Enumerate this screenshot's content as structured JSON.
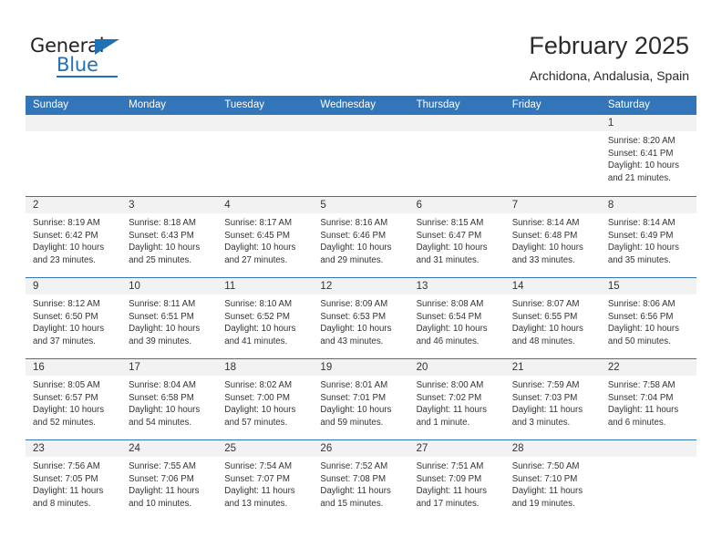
{
  "brand": {
    "name_top": "General",
    "name_bottom": "Blue",
    "color": "#2071b5"
  },
  "header": {
    "month_title": "February 2025",
    "location": "Archidona, Andalusia, Spain"
  },
  "calendar": {
    "header_color": "#3275b8",
    "weekdays": [
      "Sunday",
      "Monday",
      "Tuesday",
      "Wednesday",
      "Thursday",
      "Friday",
      "Saturday"
    ],
    "weeks": [
      [
        {
          "empty": true
        },
        {
          "empty": true
        },
        {
          "empty": true
        },
        {
          "empty": true
        },
        {
          "empty": true
        },
        {
          "empty": true
        },
        {
          "day": "1",
          "sunrise": "Sunrise: 8:20 AM",
          "sunset": "Sunset: 6:41 PM",
          "daylight_1": "Daylight: 10 hours",
          "daylight_2": "and 21 minutes."
        }
      ],
      [
        {
          "day": "2",
          "sunrise": "Sunrise: 8:19 AM",
          "sunset": "Sunset: 6:42 PM",
          "daylight_1": "Daylight: 10 hours",
          "daylight_2": "and 23 minutes."
        },
        {
          "day": "3",
          "sunrise": "Sunrise: 8:18 AM",
          "sunset": "Sunset: 6:43 PM",
          "daylight_1": "Daylight: 10 hours",
          "daylight_2": "and 25 minutes."
        },
        {
          "day": "4",
          "sunrise": "Sunrise: 8:17 AM",
          "sunset": "Sunset: 6:45 PM",
          "daylight_1": "Daylight: 10 hours",
          "daylight_2": "and 27 minutes."
        },
        {
          "day": "5",
          "sunrise": "Sunrise: 8:16 AM",
          "sunset": "Sunset: 6:46 PM",
          "daylight_1": "Daylight: 10 hours",
          "daylight_2": "and 29 minutes."
        },
        {
          "day": "6",
          "sunrise": "Sunrise: 8:15 AM",
          "sunset": "Sunset: 6:47 PM",
          "daylight_1": "Daylight: 10 hours",
          "daylight_2": "and 31 minutes."
        },
        {
          "day": "7",
          "sunrise": "Sunrise: 8:14 AM",
          "sunset": "Sunset: 6:48 PM",
          "daylight_1": "Daylight: 10 hours",
          "daylight_2": "and 33 minutes."
        },
        {
          "day": "8",
          "sunrise": "Sunrise: 8:14 AM",
          "sunset": "Sunset: 6:49 PM",
          "daylight_1": "Daylight: 10 hours",
          "daylight_2": "and 35 minutes."
        }
      ],
      [
        {
          "day": "9",
          "sunrise": "Sunrise: 8:12 AM",
          "sunset": "Sunset: 6:50 PM",
          "daylight_1": "Daylight: 10 hours",
          "daylight_2": "and 37 minutes."
        },
        {
          "day": "10",
          "sunrise": "Sunrise: 8:11 AM",
          "sunset": "Sunset: 6:51 PM",
          "daylight_1": "Daylight: 10 hours",
          "daylight_2": "and 39 minutes."
        },
        {
          "day": "11",
          "sunrise": "Sunrise: 8:10 AM",
          "sunset": "Sunset: 6:52 PM",
          "daylight_1": "Daylight: 10 hours",
          "daylight_2": "and 41 minutes."
        },
        {
          "day": "12",
          "sunrise": "Sunrise: 8:09 AM",
          "sunset": "Sunset: 6:53 PM",
          "daylight_1": "Daylight: 10 hours",
          "daylight_2": "and 43 minutes."
        },
        {
          "day": "13",
          "sunrise": "Sunrise: 8:08 AM",
          "sunset": "Sunset: 6:54 PM",
          "daylight_1": "Daylight: 10 hours",
          "daylight_2": "and 46 minutes."
        },
        {
          "day": "14",
          "sunrise": "Sunrise: 8:07 AM",
          "sunset": "Sunset: 6:55 PM",
          "daylight_1": "Daylight: 10 hours",
          "daylight_2": "and 48 minutes."
        },
        {
          "day": "15",
          "sunrise": "Sunrise: 8:06 AM",
          "sunset": "Sunset: 6:56 PM",
          "daylight_1": "Daylight: 10 hours",
          "daylight_2": "and 50 minutes."
        }
      ],
      [
        {
          "day": "16",
          "sunrise": "Sunrise: 8:05 AM",
          "sunset": "Sunset: 6:57 PM",
          "daylight_1": "Daylight: 10 hours",
          "daylight_2": "and 52 minutes."
        },
        {
          "day": "17",
          "sunrise": "Sunrise: 8:04 AM",
          "sunset": "Sunset: 6:58 PM",
          "daylight_1": "Daylight: 10 hours",
          "daylight_2": "and 54 minutes."
        },
        {
          "day": "18",
          "sunrise": "Sunrise: 8:02 AM",
          "sunset": "Sunset: 7:00 PM",
          "daylight_1": "Daylight: 10 hours",
          "daylight_2": "and 57 minutes."
        },
        {
          "day": "19",
          "sunrise": "Sunrise: 8:01 AM",
          "sunset": "Sunset: 7:01 PM",
          "daylight_1": "Daylight: 10 hours",
          "daylight_2": "and 59 minutes."
        },
        {
          "day": "20",
          "sunrise": "Sunrise: 8:00 AM",
          "sunset": "Sunset: 7:02 PM",
          "daylight_1": "Daylight: 11 hours",
          "daylight_2": "and 1 minute."
        },
        {
          "day": "21",
          "sunrise": "Sunrise: 7:59 AM",
          "sunset": "Sunset: 7:03 PM",
          "daylight_1": "Daylight: 11 hours",
          "daylight_2": "and 3 minutes."
        },
        {
          "day": "22",
          "sunrise": "Sunrise: 7:58 AM",
          "sunset": "Sunset: 7:04 PM",
          "daylight_1": "Daylight: 11 hours",
          "daylight_2": "and 6 minutes."
        }
      ],
      [
        {
          "day": "23",
          "sunrise": "Sunrise: 7:56 AM",
          "sunset": "Sunset: 7:05 PM",
          "daylight_1": "Daylight: 11 hours",
          "daylight_2": "and 8 minutes."
        },
        {
          "day": "24",
          "sunrise": "Sunrise: 7:55 AM",
          "sunset": "Sunset: 7:06 PM",
          "daylight_1": "Daylight: 11 hours",
          "daylight_2": "and 10 minutes."
        },
        {
          "day": "25",
          "sunrise": "Sunrise: 7:54 AM",
          "sunset": "Sunset: 7:07 PM",
          "daylight_1": "Daylight: 11 hours",
          "daylight_2": "and 13 minutes."
        },
        {
          "day": "26",
          "sunrise": "Sunrise: 7:52 AM",
          "sunset": "Sunset: 7:08 PM",
          "daylight_1": "Daylight: 11 hours",
          "daylight_2": "and 15 minutes."
        },
        {
          "day": "27",
          "sunrise": "Sunrise: 7:51 AM",
          "sunset": "Sunset: 7:09 PM",
          "daylight_1": "Daylight: 11 hours",
          "daylight_2": "and 17 minutes."
        },
        {
          "day": "28",
          "sunrise": "Sunrise: 7:50 AM",
          "sunset": "Sunset: 7:10 PM",
          "daylight_1": "Daylight: 11 hours",
          "daylight_2": "and 19 minutes."
        },
        {
          "empty": true
        }
      ]
    ]
  }
}
